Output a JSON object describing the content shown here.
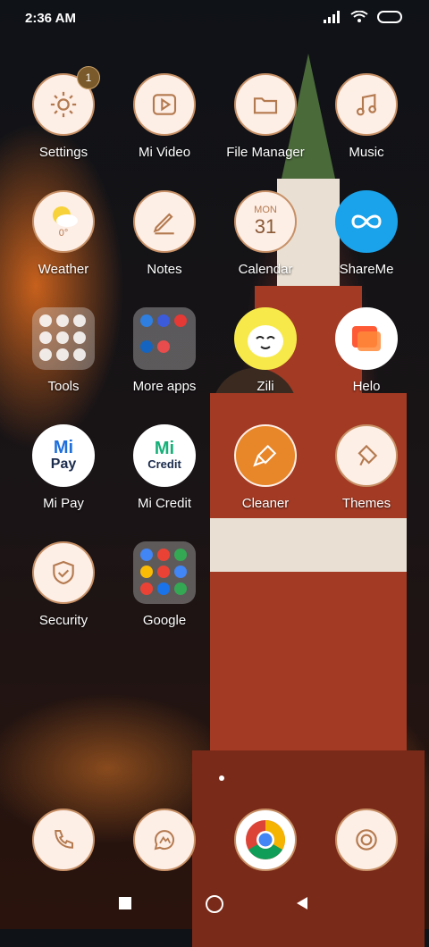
{
  "status": {
    "time": "2:36 AM"
  },
  "apps": [
    {
      "label": "Settings",
      "icon": "gear-icon",
      "badge": "1"
    },
    {
      "label": "Mi Video",
      "icon": "play-icon"
    },
    {
      "label": "File Manager",
      "icon": "folder-icon"
    },
    {
      "label": "Music",
      "icon": "music-note-icon"
    },
    {
      "label": "Weather",
      "icon": "weather-icon",
      "temp": "0°"
    },
    {
      "label": "Notes",
      "icon": "pencil-icon"
    },
    {
      "label": "Calendar",
      "icon": "calendar-icon",
      "day": "MON",
      "date": "31"
    },
    {
      "label": "ShareMe",
      "icon": "infinity-icon"
    },
    {
      "label": "Tools",
      "icon": "tools-folder-icon"
    },
    {
      "label": "More apps",
      "icon": "more-apps-folder-icon"
    },
    {
      "label": "Zili",
      "icon": "zili-face-icon"
    },
    {
      "label": "Helo",
      "icon": "helo-chat-icon"
    },
    {
      "label": "Mi Pay",
      "icon": "mi-pay-icon",
      "logo_top": "Mi",
      "logo_bottom": "Pay"
    },
    {
      "label": "Mi Credit",
      "icon": "mi-credit-icon",
      "logo_top": "Mi",
      "logo_bottom": "Credit"
    },
    {
      "label": "Cleaner",
      "icon": "broom-icon"
    },
    {
      "label": "Themes",
      "icon": "brush-icon"
    },
    {
      "label": "Security",
      "icon": "shield-icon"
    },
    {
      "label": "Google",
      "icon": "google-folder-icon"
    }
  ],
  "dock": [
    {
      "icon": "phone-icon"
    },
    {
      "icon": "messages-icon"
    },
    {
      "icon": "chrome-icon"
    },
    {
      "icon": "camera-icon"
    }
  ],
  "nav": [
    "recents-icon",
    "home-icon",
    "back-icon"
  ]
}
